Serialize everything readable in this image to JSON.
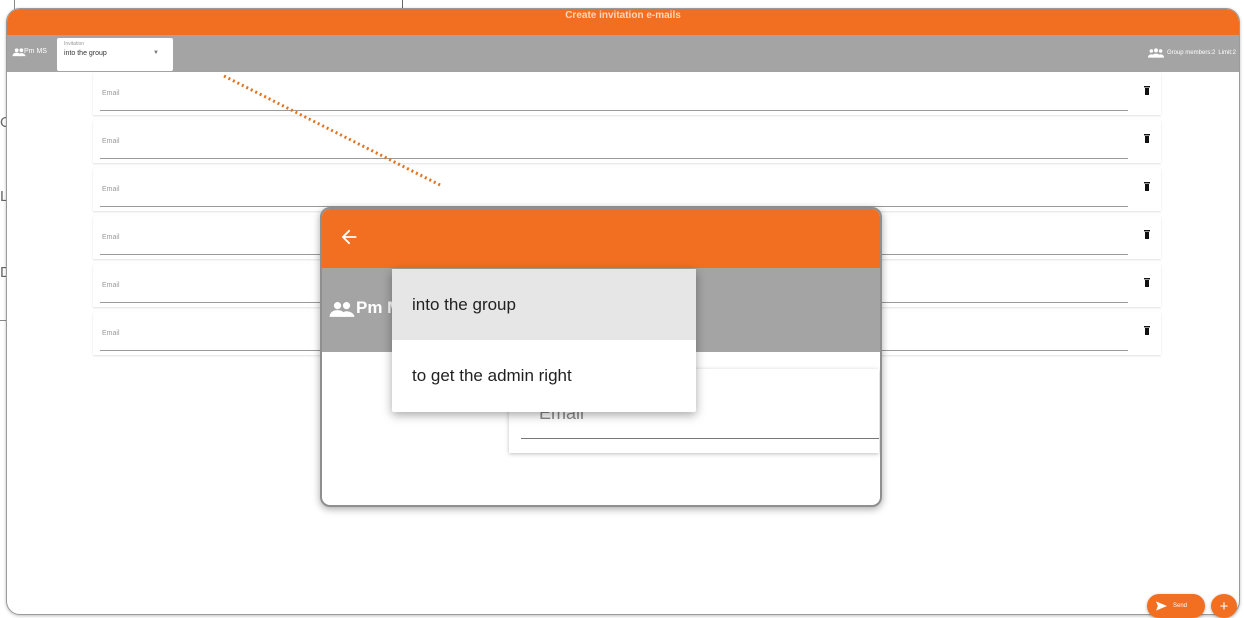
{
  "window": {
    "title": "Create invitation e-mails"
  },
  "toolbar": {
    "group_name": "Pm MS",
    "invitation_label": "Invitation",
    "invitation_value": "into the group",
    "group_members": "Group members:2",
    "limit": "Limit:2"
  },
  "email_rows": [
    {
      "placeholder": "Email"
    },
    {
      "placeholder": "Email"
    },
    {
      "placeholder": "Email"
    },
    {
      "placeholder": "Email"
    },
    {
      "placeholder": "Email"
    },
    {
      "placeholder": "Email"
    }
  ],
  "inset": {
    "group_name": "Pm M",
    "email_placeholder": "Email",
    "dropdown_options": [
      "into the group",
      "to get the admin right"
    ],
    "selected_option": "into the group"
  },
  "actions": {
    "send_label": "Send",
    "add_label": "+"
  },
  "background": {
    "letters": [
      "O",
      "L",
      "D"
    ]
  },
  "colors": {
    "accent": "#f26f22",
    "toolbar": "#a4a4a4"
  }
}
